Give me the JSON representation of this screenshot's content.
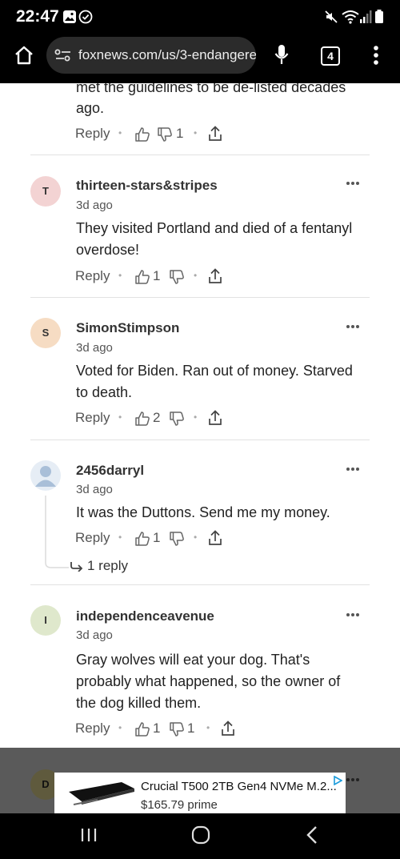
{
  "status_bar": {
    "time": "22:47"
  },
  "browser": {
    "url": "foxnews.com/us/3-endangere",
    "tab_count": "4"
  },
  "partial_comment": {
    "text_line1": "met the guidelines to be de-listed decades",
    "text_line2": "ago.",
    "reply": "Reply",
    "likes": "",
    "dislikes": "1"
  },
  "comments": [
    {
      "avatar_letter": "T",
      "avatar_color": "#f3d3d3",
      "username": "thirteen-stars&stripes",
      "time": "3d ago",
      "line1": "They visited Portland and died of a fentanyl",
      "line2": "overdose!",
      "line3": "",
      "reply": "Reply",
      "likes": "1",
      "dislikes": ""
    },
    {
      "avatar_letter": "S",
      "avatar_color": "#f6dcc3",
      "username": "SimonStimpson",
      "time": "3d ago",
      "line1": "Voted for Biden.  Ran out of money.  Starved",
      "line2": "to death.",
      "line3": "",
      "reply": "Reply",
      "likes": "2",
      "dislikes": ""
    },
    {
      "avatar_letter": "",
      "avatar_color": "#e6edf5",
      "username": "2456darryl",
      "time": "3d ago",
      "line1": "It was the Duttons. Send me my money.",
      "line2": "",
      "line3": "",
      "reply": "Reply",
      "likes": "1",
      "dislikes": "",
      "replies_link": "1 reply"
    },
    {
      "avatar_letter": "I",
      "avatar_color": "#dfe8cc",
      "username": "independenceavenue",
      "time": "3d ago",
      "line1": "Gray wolves will eat your dog. That's",
      "line2": "probably what happened, so the owner of",
      "line3": "the dog killed them.",
      "reply": "Reply",
      "likes": "1",
      "dislikes": "1"
    }
  ],
  "next_avatar_letter": "D",
  "ad": {
    "title": "Crucial T500 2TB Gen4 NVMe M.2...",
    "price_partial": "$165.79 prime"
  },
  "colors": {
    "accent_blue": "#1f6fd1",
    "icon_gray": "#666666",
    "bar_black": "#000000"
  }
}
